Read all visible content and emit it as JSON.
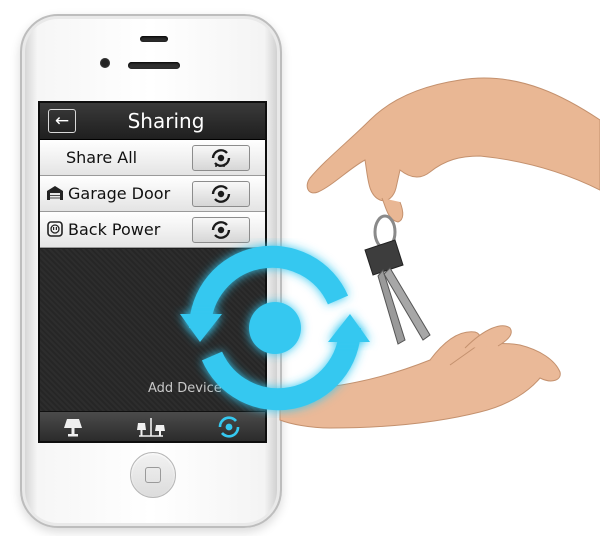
{
  "screen": {
    "title": "Sharing",
    "back_label": "←",
    "rows": [
      {
        "label": "Share All",
        "icon": "none"
      },
      {
        "label": "Garage Door",
        "icon": "garage-icon"
      },
      {
        "label": "Back Power",
        "icon": "power-outlet-icon"
      }
    ],
    "add_device_label": "Add Device",
    "add_icon_glyph": "+",
    "tabs": [
      "lamp-icon",
      "device-tree-icon",
      "share-sync-icon"
    ]
  },
  "colors": {
    "accent": "#35c8f0",
    "glow": "#1fb6ee",
    "screen_bg": "#262626",
    "row_bg": "#f2f2f2"
  }
}
